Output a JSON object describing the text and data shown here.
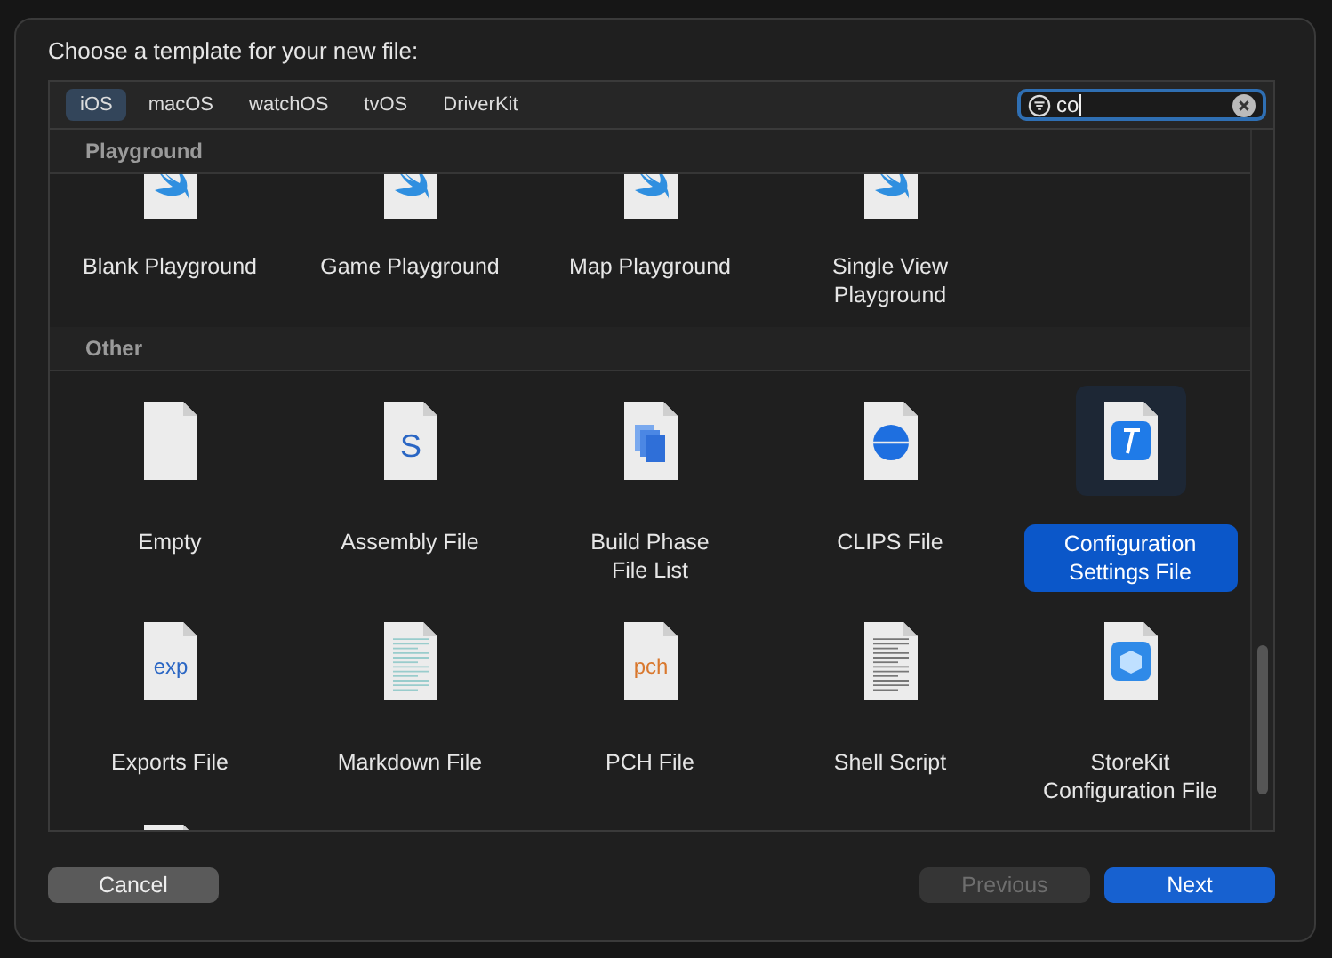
{
  "dialog": {
    "title": "Choose a template for your new file:"
  },
  "tabs": [
    {
      "label": "iOS",
      "selected": true
    },
    {
      "label": "macOS",
      "selected": false
    },
    {
      "label": "watchOS",
      "selected": false
    },
    {
      "label": "tvOS",
      "selected": false
    },
    {
      "label": "DriverKit",
      "selected": false
    }
  ],
  "search": {
    "value": "co"
  },
  "sections": [
    {
      "title": "Playground",
      "items": [
        {
          "label": "Blank Playground",
          "kind": "swift",
          "clipped_top": true,
          "selected": false
        },
        {
          "label": "Game Playground",
          "kind": "swift",
          "clipped_top": true,
          "selected": false
        },
        {
          "label": "Map Playground",
          "kind": "swift",
          "clipped_top": true,
          "selected": false
        },
        {
          "label": "Single View Playground",
          "kind": "swift",
          "clipped_top": true,
          "selected": false
        }
      ]
    },
    {
      "title": "Other",
      "items": [
        {
          "label": "Empty",
          "kind": "blank",
          "selected": false
        },
        {
          "label": "Assembly File",
          "kind": "letter",
          "glyph": "S",
          "selected": false
        },
        {
          "label": "Build Phase File List",
          "kind": "pages",
          "selected": false
        },
        {
          "label": "CLIPS File",
          "kind": "sphere",
          "selected": false
        },
        {
          "label": "Configuration Settings File",
          "kind": "hammer",
          "selected": true
        },
        {
          "label": "Exports File",
          "kind": "letter",
          "glyph": "exp",
          "selected": false
        },
        {
          "label": "Markdown File",
          "kind": "markdown",
          "selected": false
        },
        {
          "label": "PCH File",
          "kind": "orange-letter",
          "glyph": "pch",
          "selected": false
        },
        {
          "label": "Shell Script",
          "kind": "text",
          "selected": false
        },
        {
          "label": "StoreKit Configuration File",
          "kind": "box",
          "selected": false
        },
        {
          "kind": "green",
          "clipped_bottom": true,
          "selected": false
        }
      ]
    }
  ],
  "buttons": {
    "cancel": "Cancel",
    "previous": "Previous",
    "next": "Next",
    "previous_disabled": true
  }
}
